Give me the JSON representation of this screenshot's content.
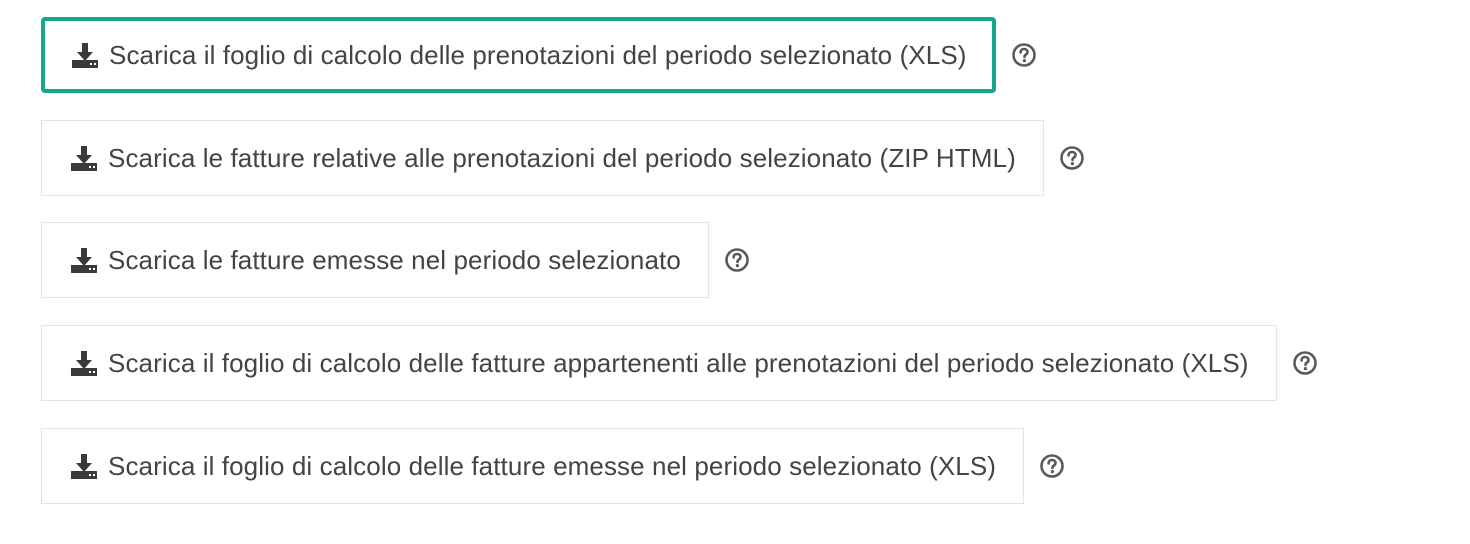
{
  "downloads": [
    {
      "label": "Scarica il foglio di calcolo delle prenotazioni del periodo selezionato (XLS)",
      "icon": "download-icon",
      "help_icon": "help-icon",
      "focused": true
    },
    {
      "label": "Scarica le fatture relative alle prenotazioni del periodo selezionato (ZIP HTML)",
      "icon": "download-icon",
      "help_icon": "help-icon",
      "focused": false
    },
    {
      "label": "Scarica le fatture emesse nel periodo selezionato",
      "icon": "download-icon",
      "help_icon": "help-icon",
      "focused": false
    },
    {
      "label": "Scarica il foglio di calcolo delle fatture appartenenti alle prenotazioni del periodo selezionato (XLS)",
      "icon": "download-icon",
      "help_icon": "help-icon",
      "focused": false
    },
    {
      "label": "Scarica il foglio di calcolo delle fatture emesse nel periodo selezionato (XLS)",
      "icon": "download-icon",
      "help_icon": "help-icon",
      "focused": false
    }
  ],
  "colors": {
    "focus_ring": "#17a58f",
    "text": "#444444",
    "icon": "#3a3a3a",
    "help_icon": "#5a5a5a",
    "border": "#e4e4e4"
  }
}
